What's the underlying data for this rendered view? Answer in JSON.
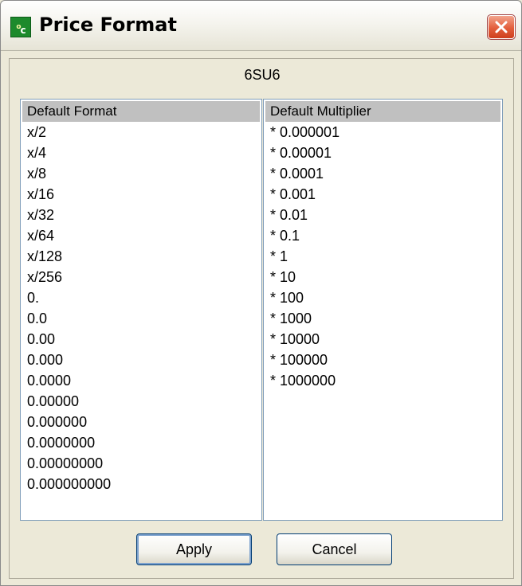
{
  "window": {
    "title": "Price Format",
    "icon": "price-format-app-icon",
    "icon_text_sup": "o",
    "icon_text": "c",
    "close_icon": "close-icon"
  },
  "dialog": {
    "symbol": "6SU6"
  },
  "format_list": {
    "header": "Default Format",
    "items": [
      "x/2",
      "x/4",
      "x/8",
      "x/16",
      "x/32",
      "x/64",
      "x/128",
      "x/256",
      "0.",
      "0.0",
      "0.00",
      "0.000",
      "0.0000",
      "0.00000",
      "0.000000",
      "0.0000000",
      "0.00000000",
      "0.000000000"
    ]
  },
  "multiplier_list": {
    "header": "Default Multiplier",
    "items": [
      "* 0.000001",
      "* 0.00001",
      "* 0.0001",
      "* 0.001",
      "* 0.01",
      "* 0.1",
      "* 1",
      "* 10",
      "* 100",
      "* 1000",
      "* 10000",
      "* 100000",
      "* 1000000"
    ]
  },
  "buttons": {
    "apply": "Apply",
    "cancel": "Cancel"
  },
  "colors": {
    "window_bg": "#ece9d8",
    "close_button": "#e35e3c",
    "app_icon": "#1d8a2c",
    "list_header_bg": "#c0c0c0",
    "list_border": "#7f9db9"
  }
}
